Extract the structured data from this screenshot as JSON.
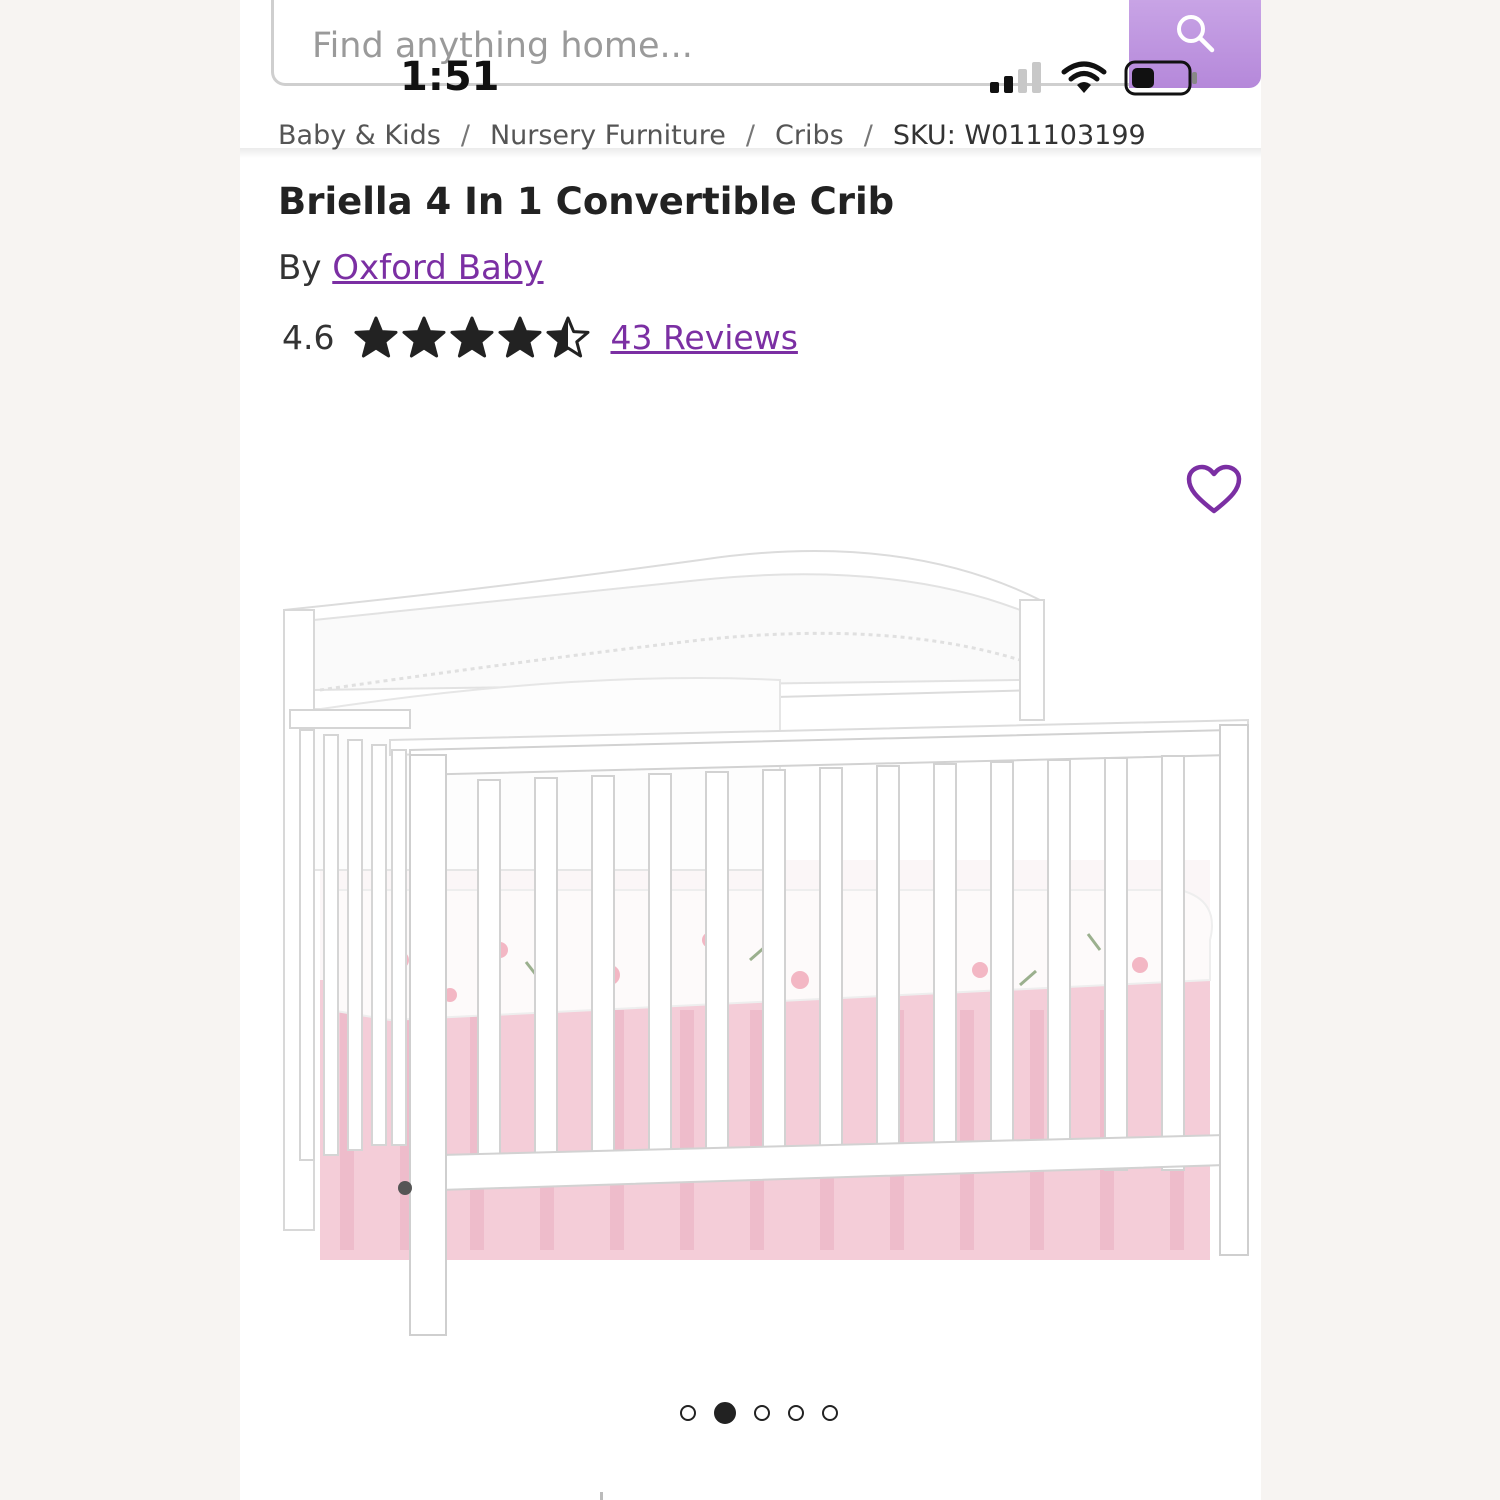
{
  "search": {
    "placeholder": "Find anything home..."
  },
  "status_bar": {
    "time": "1:51"
  },
  "breadcrumb": {
    "items": [
      "Baby & Kids",
      "Nursery Furniture",
      "Cribs"
    ],
    "separator": "/",
    "sku": "SKU: W011103199"
  },
  "product": {
    "title": "Briella 4 In 1 Convertible Crib",
    "by_prefix": "By",
    "brand": "Oxford Baby",
    "rating": "4.6",
    "rating_value": 4.6,
    "stars_out_of": 5,
    "reviews": "43 Reviews"
  },
  "carousel": {
    "total": 5,
    "active_index": 1
  },
  "colors": {
    "accent": "#7b2fa3",
    "search_button": "#b98cdc",
    "crib": "#ffffff",
    "bed_skirt": "#f4cdd8"
  },
  "icons": {
    "search": "search-icon",
    "favorite": "heart-outline-icon",
    "star_full": "star-icon",
    "star_half": "star-half-icon"
  }
}
